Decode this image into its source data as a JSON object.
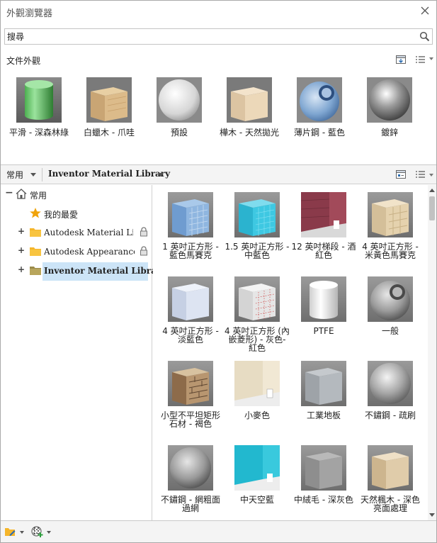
{
  "window": {
    "title": "外觀瀏覽器"
  },
  "search": {
    "value": "搜尋"
  },
  "document": {
    "label": "文件外觀",
    "items": [
      {
        "label": "平滑 - 深森林綠",
        "icon": "green-cylinder-thumbnail"
      },
      {
        "label": "白蠟木 - 爪哇",
        "icon": "ash-wood-cube-thumbnail"
      },
      {
        "label": "預設",
        "icon": "white-sphere-thumbnail"
      },
      {
        "label": "樺木 - 天然拋光",
        "icon": "birch-cube-thumbnail"
      },
      {
        "label": "薄片鋼 - 藍色",
        "icon": "blue-metal-sphere-thumbnail"
      },
      {
        "label": "鍍鋅",
        "icon": "galvanized-sphere-thumbnail"
      }
    ]
  },
  "library_toolbar": {
    "view_dropdown": "常用",
    "library_dropdown": "Inventor Material Library"
  },
  "tree": {
    "root": "常用",
    "favorites": "我的最愛",
    "libraries": [
      {
        "label": "Autodesk Material Library",
        "locked": true
      },
      {
        "label": "Autodesk Appearance Li···",
        "locked": true
      },
      {
        "label": "Inventor Material Library",
        "locked": false,
        "selected": true
      }
    ]
  },
  "grid": {
    "items": [
      {
        "label": "1 英吋正方形 - 藍色馬賽克",
        "icon": "blue-mosaic-cube-thumbnail"
      },
      {
        "label": "1.5 英吋正方形 - 中藍色",
        "icon": "cyan-tile-cube-thumbnail"
      },
      {
        "label": "12 英吋梯段 - 酒紅色",
        "icon": "burgundy-wall-thumbnail"
      },
      {
        "label": "4 英吋正方形 - 米黃色馬賽克",
        "icon": "beige-tile-cube-thumbnail"
      },
      {
        "label": "4 英吋正方形 - 淡藍色",
        "icon": "light-blue-cube-thumbnail"
      },
      {
        "label": "4 英吋正方形 (內嵌菱形) - 灰色-紅色",
        "icon": "grey-red-tile-cube-thumbnail"
      },
      {
        "label": "PTFE",
        "icon": "white-cylinder-thumbnail"
      },
      {
        "label": "一般",
        "icon": "grey-sphere-thumbnail"
      },
      {
        "label": "小型不平坦矩形石材 - 褐色",
        "icon": "stone-cube-thumbnail"
      },
      {
        "label": "小麥色",
        "icon": "wheat-wall-thumbnail"
      },
      {
        "label": "工業地板",
        "icon": "grey-floor-cube-thumbnail"
      },
      {
        "label": "不鏽鋼 - 疏刷",
        "icon": "steel-sphere-thumbnail"
      },
      {
        "label": "不鏽鋼 - 網粗面過網",
        "icon": "steel-mesh-sphere-thumbnail"
      },
      {
        "label": "中天空藍",
        "icon": "sky-blue-wall-thumbnail"
      },
      {
        "label": "中絨毛 - 深灰色",
        "icon": "carpet-cube-thumbnail"
      },
      {
        "label": "天然楓木 - 深色亮面處理",
        "icon": "maple-cube-thumbnail"
      }
    ]
  },
  "colors": {
    "selection": "#cce4f7",
    "folder": "#f5b52a",
    "star": "#f0a30a"
  }
}
